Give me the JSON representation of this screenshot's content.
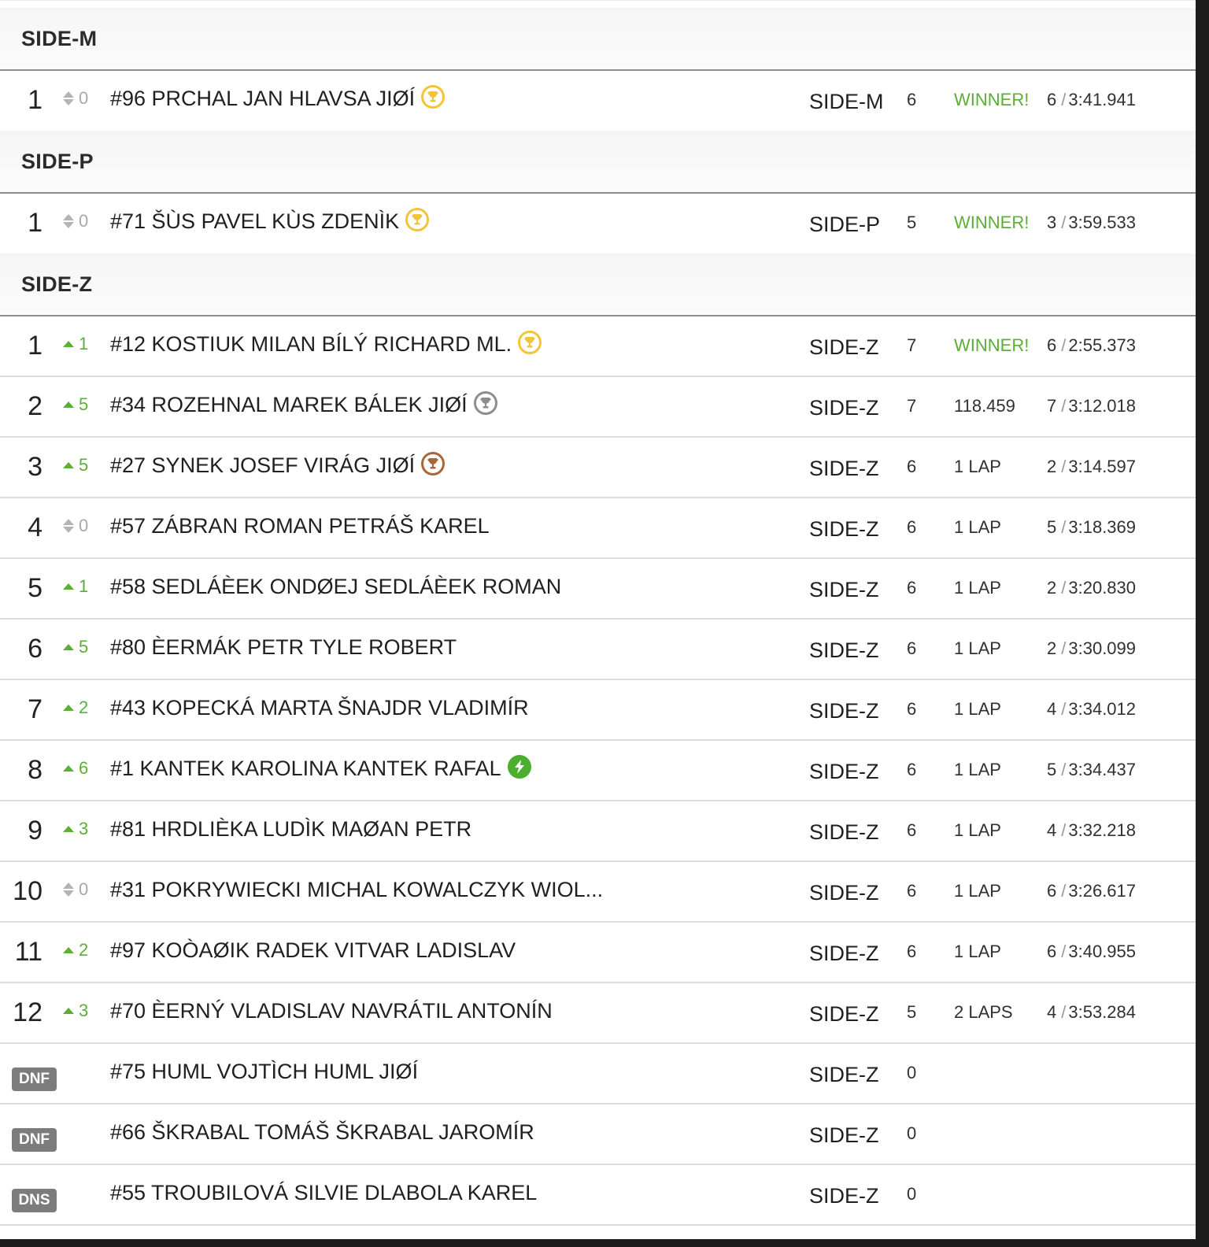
{
  "groups": [
    {
      "title": "SIDE-M",
      "rows": [
        {
          "pos": "1",
          "change": "0",
          "change_dir": "same",
          "name": "#96 PRCHAL JAN HLAVSA JIØÍ",
          "badge": "gold",
          "class": "SIDE-M",
          "laps": "6",
          "gap": "WINNER!",
          "gap_winner": true,
          "best_lap": "6",
          "best_time": "3:41.941"
        }
      ]
    },
    {
      "title": "SIDE-P",
      "rows": [
        {
          "pos": "1",
          "change": "0",
          "change_dir": "same",
          "name": "#71 ŠÙS PAVEL KÙS ZDENÌK",
          "badge": "gold",
          "class": "SIDE-P",
          "laps": "5",
          "gap": "WINNER!",
          "gap_winner": true,
          "best_lap": "3",
          "best_time": "3:59.533"
        }
      ]
    },
    {
      "title": "SIDE-Z",
      "rows": [
        {
          "pos": "1",
          "change": "1",
          "change_dir": "up",
          "name": "#12 KOSTIUK MILAN BÍLÝ RICHARD ML.",
          "badge": "gold",
          "class": "SIDE-Z",
          "laps": "7",
          "gap": "WINNER!",
          "gap_winner": true,
          "best_lap": "6",
          "best_time": "2:55.373"
        },
        {
          "pos": "2",
          "change": "5",
          "change_dir": "up",
          "name": "#34 ROZEHNAL MAREK BÁLEK JIØÍ",
          "badge": "silver",
          "class": "SIDE-Z",
          "laps": "7",
          "gap": "118.459",
          "gap_winner": false,
          "best_lap": "7",
          "best_time": "3:12.018"
        },
        {
          "pos": "3",
          "change": "5",
          "change_dir": "up",
          "name": "#27 SYNEK JOSEF VIRÁG JIØÍ",
          "badge": "bronze",
          "class": "SIDE-Z",
          "laps": "6",
          "gap": "1 LAP",
          "gap_winner": false,
          "best_lap": "2",
          "best_time": "3:14.597"
        },
        {
          "pos": "4",
          "change": "0",
          "change_dir": "same",
          "name": "#57 ZÁBRAN ROMAN PETRÁŠ KAREL",
          "badge": "",
          "class": "SIDE-Z",
          "laps": "6",
          "gap": "1 LAP",
          "gap_winner": false,
          "best_lap": "5",
          "best_time": "3:18.369"
        },
        {
          "pos": "5",
          "change": "1",
          "change_dir": "up",
          "name": "#58 SEDLÁÈEK ONDØEJ SEDLÁÈEK ROMAN",
          "badge": "",
          "class": "SIDE-Z",
          "laps": "6",
          "gap": "1 LAP",
          "gap_winner": false,
          "best_lap": "2",
          "best_time": "3:20.830"
        },
        {
          "pos": "6",
          "change": "5",
          "change_dir": "up",
          "name": "#80 ÈERMÁK PETR TYLE ROBERT",
          "badge": "",
          "class": "SIDE-Z",
          "laps": "6",
          "gap": "1 LAP",
          "gap_winner": false,
          "best_lap": "2",
          "best_time": "3:30.099"
        },
        {
          "pos": "7",
          "change": "2",
          "change_dir": "up",
          "name": "#43 KOPECKÁ MARTA ŠNAJDR VLADIMÍR",
          "badge": "",
          "class": "SIDE-Z",
          "laps": "6",
          "gap": "1 LAP",
          "gap_winner": false,
          "best_lap": "4",
          "best_time": "3:34.012"
        },
        {
          "pos": "8",
          "change": "6",
          "change_dir": "up",
          "name": "#1 KANTEK KAROLINA KANTEK RAFAL",
          "badge": "bolt",
          "class": "SIDE-Z",
          "laps": "6",
          "gap": "1 LAP",
          "gap_winner": false,
          "best_lap": "5",
          "best_time": "3:34.437"
        },
        {
          "pos": "9",
          "change": "3",
          "change_dir": "up",
          "name": "#81 HRDLIÈKA LUDÌK MAØAN PETR",
          "badge": "",
          "class": "SIDE-Z",
          "laps": "6",
          "gap": "1 LAP",
          "gap_winner": false,
          "best_lap": "4",
          "best_time": "3:32.218"
        },
        {
          "pos": "10",
          "change": "0",
          "change_dir": "same",
          "name": "#31 POKRYWIECKI MICHAL KOWALCZYK WIOL...",
          "badge": "",
          "class": "SIDE-Z",
          "laps": "6",
          "gap": "1 LAP",
          "gap_winner": false,
          "best_lap": "6",
          "best_time": "3:26.617"
        },
        {
          "pos": "11",
          "change": "2",
          "change_dir": "up",
          "name": "#97 KOÒAØIK RADEK VITVAR LADISLAV",
          "badge": "",
          "class": "SIDE-Z",
          "laps": "6",
          "gap": "1 LAP",
          "gap_winner": false,
          "best_lap": "6",
          "best_time": "3:40.955"
        },
        {
          "pos": "12",
          "change": "3",
          "change_dir": "up",
          "name": "#70 ÈERNÝ VLADISLAV NAVRÁTIL ANTONÍN",
          "badge": "",
          "class": "SIDE-Z",
          "laps": "5",
          "gap": "2 LAPS",
          "gap_winner": false,
          "best_lap": "4",
          "best_time": "3:53.284"
        },
        {
          "status": "DNF",
          "name": "#75 HUML VOJTÌCH HUML JIØÍ",
          "class": "SIDE-Z",
          "laps": "0"
        },
        {
          "status": "DNF",
          "name": "#66 ŠKRABAL TOMÁŠ ŠKRABAL JAROMÍR",
          "class": "SIDE-Z",
          "laps": "0"
        },
        {
          "status": "DNS",
          "name": "#55 TROUBILOVÁ SILVIE DLABOLA KAREL",
          "class": "SIDE-Z",
          "laps": "0"
        }
      ]
    }
  ],
  "colors": {
    "accent_green": "#5cae35",
    "gold": "#f2c43a",
    "silver": "#8d8d8d",
    "bronze": "#a8673a",
    "status_badge": "#7c7c7c"
  },
  "icons": {
    "gold": "trophy-gold-icon",
    "silver": "trophy-silver-icon",
    "bronze": "trophy-bronze-icon",
    "bolt": "fastest-lap-bolt-icon",
    "same": "no-change-icon",
    "up": "position-up-icon"
  }
}
